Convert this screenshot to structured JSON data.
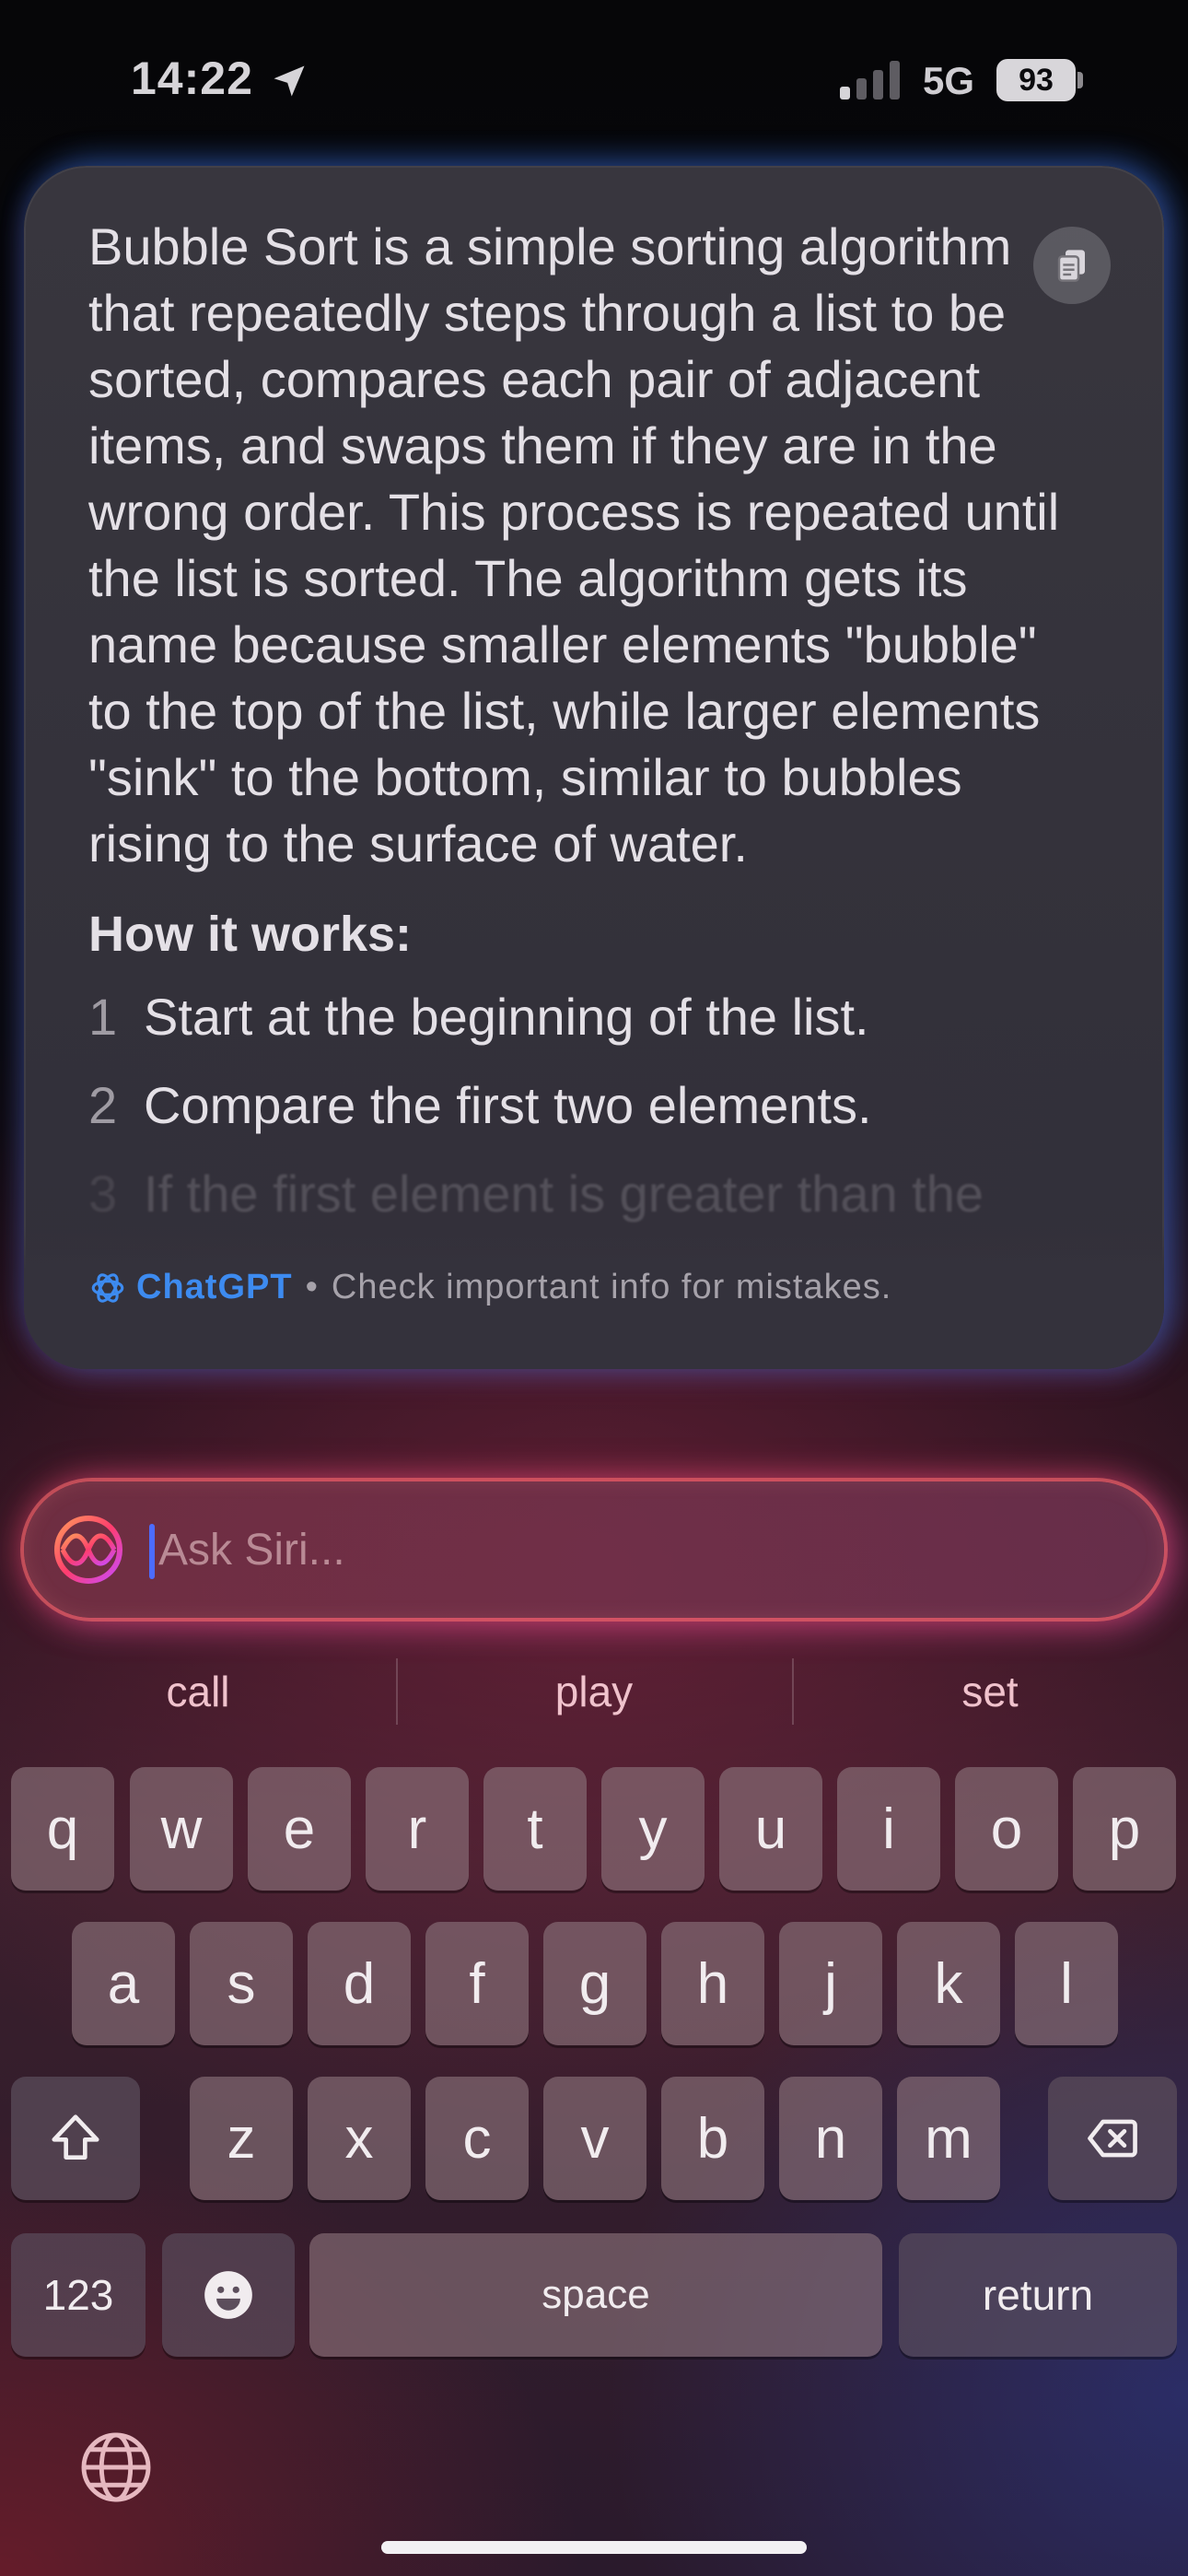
{
  "status_bar": {
    "time": "14:22",
    "network": "5G",
    "battery": "93"
  },
  "response": {
    "paragraph": "Bubble Sort is a simple sorting algorithm that repeatedly steps through a list to be sorted, compares each pair of adjacent items, and swaps them if they are in the wrong order. This process is repeated until the list is sorted. The algorithm gets its name because smaller elements \"bubble\" to the top of the list, while larger elements \"sink\" to the bottom, similar to bubbles rising to the surface of water.",
    "heading": "How it works:",
    "steps": [
      {
        "number": "1",
        "text": "Start at the beginning of the list."
      },
      {
        "number": "2",
        "text": "Compare the first two elements."
      },
      {
        "number": "3",
        "text": "If the first element is greater than the"
      }
    ],
    "source_label": "ChatGPT",
    "separator": "•",
    "disclaimer": "Check important info for mistakes."
  },
  "siri": {
    "placeholder": "Ask Siri..."
  },
  "suggestions": [
    "call",
    "play",
    "set"
  ],
  "keyboard": {
    "row1": [
      "q",
      "w",
      "e",
      "r",
      "t",
      "y",
      "u",
      "i",
      "o",
      "p"
    ],
    "row2": [
      "a",
      "s",
      "d",
      "f",
      "g",
      "h",
      "j",
      "k",
      "l"
    ],
    "row3": [
      "z",
      "x",
      "c",
      "v",
      "b",
      "n",
      "m"
    ],
    "numbers_label": "123",
    "space_label": "space",
    "return_label": "return"
  },
  "colors": {
    "accent_blue": "#3d8bf0",
    "siri_glow": "#ff5a6e"
  }
}
